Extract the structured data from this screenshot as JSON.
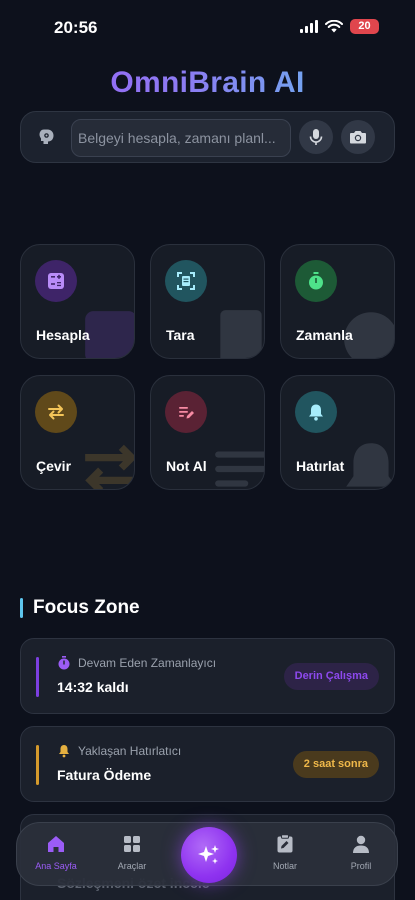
{
  "status": {
    "time": "20:56",
    "battery": "20"
  },
  "app": {
    "title": "OmniBrain AI"
  },
  "search": {
    "placeholder": "Belgeyi hesapla, zamanı planl..."
  },
  "colors": {
    "accent_purple": "#9b5cf6",
    "accent_cyan": "#5ec6ee",
    "accent_green": "#22c55e",
    "accent_amber": "#e5b040",
    "accent_pink": "#f06b8a",
    "background": "#0d111c"
  },
  "tiles": [
    {
      "label": "Hesapla",
      "icon": "calculator-icon",
      "color": "#9b5cf6"
    },
    {
      "label": "Tara",
      "icon": "scan-icon",
      "color": "#5ec6ee"
    },
    {
      "label": "Zamanla",
      "icon": "timer-icon",
      "color": "#22c55e"
    },
    {
      "label": "Çevir",
      "icon": "swap-icon",
      "color": "#e5b040"
    },
    {
      "label": "Not Al",
      "icon": "note-edit-icon",
      "color": "#f06b8a"
    },
    {
      "label": "Hatırlat",
      "icon": "bell-icon",
      "color": "#5ec6ee"
    }
  ],
  "focus_zone": {
    "title": "Focus Zone",
    "cards": [
      {
        "kicker": "Devam Eden Zamanlayıcı",
        "main": "14:32 kaldı",
        "badge": "Derin Çalışma",
        "icon": "timer-icon"
      },
      {
        "kicker": "Yaklaşan Hatırlatıcı",
        "main": "Fatura Ödeme",
        "badge": "2 saat sonra",
        "icon": "bell-icon"
      }
    ],
    "peek_text": "Sözleşmeni özet incele"
  },
  "tabbar": {
    "items": [
      {
        "label": "Ana Sayfa",
        "icon": "home-icon",
        "active": true
      },
      {
        "label": "Araçlar",
        "icon": "grid-icon",
        "active": false
      },
      {
        "label": "Notlar",
        "icon": "clipboard-edit-icon",
        "active": false
      },
      {
        "label": "Profil",
        "icon": "user-icon",
        "active": false
      }
    ],
    "fab_icon": "sparkles-icon"
  }
}
